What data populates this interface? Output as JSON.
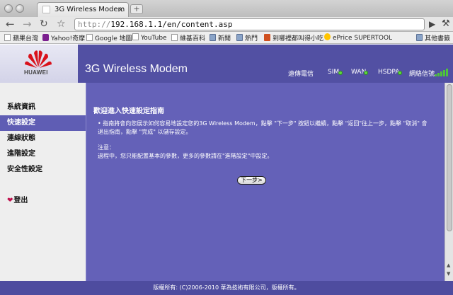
{
  "browser": {
    "tab_title": "3G Wireless Modem",
    "url_protocol": "http://",
    "url_rest": "192.168.1.1/en/content.asp",
    "bookmarks": [
      {
        "label": "蘋果台灣",
        "icon": "page"
      },
      {
        "label": "Yahoo!奇摩",
        "icon": "yahoo"
      },
      {
        "label": "Google 地圖",
        "icon": "page"
      },
      {
        "label": "YouTube",
        "icon": "page"
      },
      {
        "label": "維基百科",
        "icon": "page"
      },
      {
        "label": "新聞",
        "icon": "folder"
      },
      {
        "label": "熱門",
        "icon": "folder"
      },
      {
        "label": "到哪裡都叫得小吃",
        "icon": "red"
      },
      {
        "label": "ePrice SUPERTOOL",
        "icon": "eprice"
      },
      {
        "label": "其他書籤",
        "icon": "folder"
      }
    ]
  },
  "header": {
    "logo_text": "HUAWEI",
    "title": "3G Wireless Modem",
    "operator": "遠傳電信",
    "status": {
      "sim": "SIM",
      "wan": "WAN",
      "hsdpa": "HSDPA",
      "signal": "網絡信號"
    },
    "status_color": "#5ed63d"
  },
  "sidebar": {
    "items": [
      {
        "label": "系統資訊",
        "active": false
      },
      {
        "label": "快速設定",
        "active": true
      },
      {
        "label": "連線狀態",
        "active": false
      },
      {
        "label": "進階設定",
        "active": false
      },
      {
        "label": "安全性設定",
        "active": false
      }
    ],
    "logout": "登出"
  },
  "content": {
    "title": "歡迎進入快速設定指南",
    "bullet": "指南將會向您展示如何容易地設定您的3G Wireless Modem，點擊 \"下一步\" 按鈕以繼續，點擊 \"返回\"往上一步，點擊 \"取消\" 會退出指南，點擊 \"完成\" 以儲存設定。",
    "note_heading": "注意：",
    "note": "過程中，您只能配置基本的參數，更多的參數請在\"進階設定\"中設定。",
    "next_button": "下一步>"
  },
  "footer": {
    "copyright": "版權所有: (C)2006-2010 華為技術有限公司，版權所有。"
  },
  "colors": {
    "page_purple": "#5f5db4",
    "header_purple": "#5250a3",
    "sidebar_bg": "#eeeeee"
  }
}
